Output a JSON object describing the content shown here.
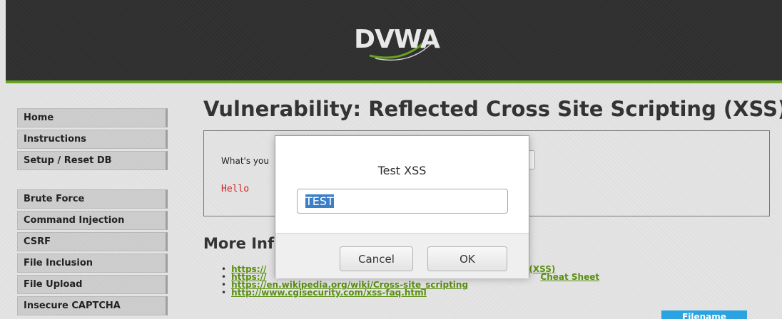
{
  "header": {
    "logo_text": "DVWA",
    "accent_color": "#66a31e"
  },
  "sidebar": {
    "items": [
      {
        "label": "Home"
      },
      {
        "label": "Instructions"
      },
      {
        "label": "Setup / Reset DB"
      },
      {
        "label": "Brute Force"
      },
      {
        "label": "Command Injection"
      },
      {
        "label": "CSRF"
      },
      {
        "label": "File Inclusion"
      },
      {
        "label": "File Upload"
      },
      {
        "label": "Insecure CAPTCHA"
      }
    ]
  },
  "main": {
    "title": "Vulnerability: Reflected Cross Site Scripting (XSS)",
    "prompt_label": "What's you",
    "hello_text": "Hello",
    "more_info_heading": "More Inf",
    "links": [
      "https://",
      "https://",
      "https://en.wikipedia.org/wiki/Cross-site_scripting",
      "http://www.cgisecurity.com/xss-faq.html"
    ],
    "link_fragments": [
      "(XSS)",
      "Cheat Sheet"
    ]
  },
  "dialog": {
    "title": "Test XSS",
    "input_value": "TEST",
    "cancel_label": "Cancel",
    "ok_label": "OK",
    "selection_color": "#3a7fc8"
  },
  "corner_tab": {
    "label": "Filename",
    "color": "#2aa3e0"
  }
}
